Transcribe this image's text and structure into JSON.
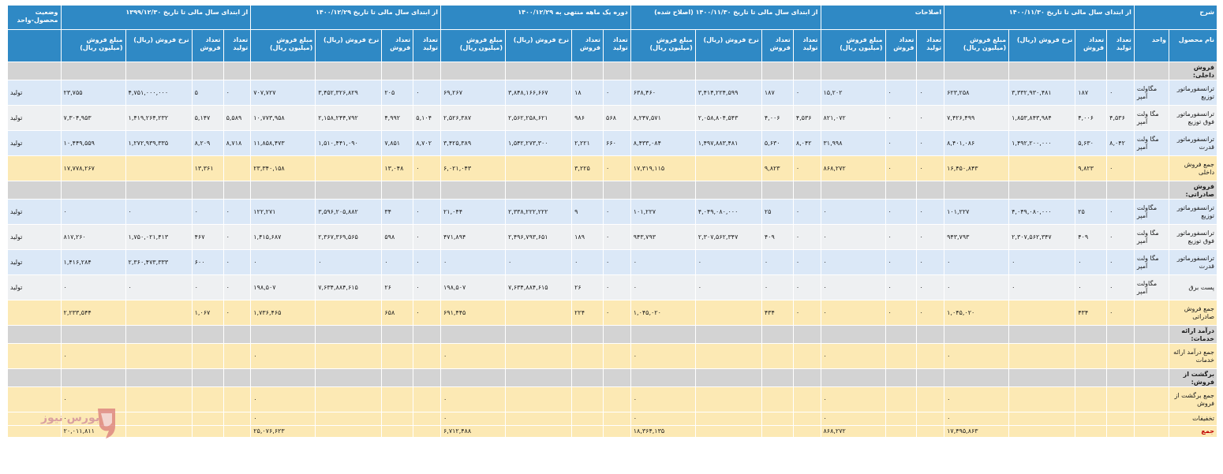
{
  "watermark": "بورس نیوز",
  "headers": {
    "row1": [
      {
        "label": "شرح",
        "colspan": 2
      },
      {
        "label": "از ابتدای سال مالی تا تاریخ ۱۴۰۰/۱۱/۳۰",
        "colspan": 4
      },
      {
        "label": "اصلاحات",
        "colspan": 3
      },
      {
        "label": "از ابتدای سال مالی تا تاریخ ۱۴۰۰/۱۱/۳۰ (اصلاح شده)",
        "colspan": 4
      },
      {
        "label": "دوره یک ماهه منتهی به ۱۴۰۰/۱۲/۲۹",
        "colspan": 4
      },
      {
        "label": "از ابتدای سال مالی تا تاریخ ۱۴۰۰/۱۲/۲۹",
        "colspan": 4
      },
      {
        "label": "از ابتدای سال مالی تا تاریخ ۱۳۹۹/۱۲/۳۰",
        "colspan": 4
      },
      {
        "label": "وضعیت محصول-واحد",
        "colspan": 1
      }
    ],
    "row2": [
      "نام محصول",
      "واحد",
      "تعداد تولید",
      "تعداد فروش",
      "نرخ فروش (ریال)",
      "مبلغ فروش (میلیون ریال)",
      "تعداد تولید",
      "تعداد فروش",
      "مبلغ فروش (میلیون ریال)",
      "تعداد تولید",
      "تعداد فروش",
      "نرخ فروش (ریال)",
      "مبلغ فروش (میلیون ریال)",
      "تعداد تولید",
      "تعداد فروش",
      "نرخ فروش (ریال)",
      "مبلغ فروش (میلیون ریال)",
      "تعداد تولید",
      "تعداد فروش",
      "نرخ فروش (ریال)",
      "مبلغ فروش (میلیون ریال)",
      "تعداد تولید",
      "تعداد فروش",
      "نرخ فروش (ریال)",
      "مبلغ فروش (میلیون ریال)",
      ""
    ]
  },
  "rows": [
    {
      "type": "sec",
      "label": "فروش داخلی:"
    },
    {
      "type": "dat",
      "shade": "a",
      "cells": [
        "ترانسفورماتور توزیع",
        "مگاولت آمپر",
        "۰",
        "۱۸۷",
        "۳,۳۳۲,۹۳۰,۴۸۱",
        "۶۲۳,۲۵۸",
        "۰",
        "۰",
        "۱۵,۲۰۲",
        "۰",
        "۱۸۷",
        "۳,۴۱۴,۲۲۴,۵۹۹",
        "۶۳۸,۴۶۰",
        "۰",
        "۱۸",
        "۳,۸۴۸,۱۶۶,۶۶۷",
        "۶۹,۲۶۷",
        "۰",
        "۲۰۵",
        "۳,۴۵۲,۳۲۶,۸۲۹",
        "۷۰۷,۷۲۷",
        "۰",
        "۵",
        "۴,۷۵۱,۰۰۰,۰۰۰",
        "۲۳,۷۵۵",
        "تولید"
      ]
    },
    {
      "type": "dat",
      "shade": "b",
      "cells": [
        "ترانسفورماتور فوق توزیع",
        "مگا ولت آمپر",
        "۴,۵۳۶",
        "۴,۰۰۶",
        "۱,۸۵۳,۸۴۳,۹۸۴",
        "۷,۴۲۶,۴۹۹",
        "۰",
        "۰",
        "۸۲۱,۰۷۲",
        "۴,۵۳۶",
        "۴,۰۰۶",
        "۲,۰۵۸,۸۰۴,۵۴۳",
        "۸,۲۴۷,۵۷۱",
        "۵۶۸",
        "۹۸۶",
        "۲,۵۶۲,۲۵۸,۶۲۱",
        "۲,۵۲۶,۳۸۷",
        "۵,۱۰۴",
        "۴,۹۹۲",
        "۲,۱۵۸,۲۴۴,۷۹۲",
        "۱۰,۷۷۳,۹۵۸",
        "۵,۵۸۹",
        "۵,۱۴۷",
        "۱,۴۱۹,۲۶۴,۲۳۲",
        "۷,۳۰۴,۹۵۳",
        "تولید"
      ]
    },
    {
      "type": "dat",
      "shade": "a",
      "cells": [
        "ترانسفورماتور قدرت",
        "مگا ولت آمپر",
        "۸,۰۴۲",
        "۵,۶۳۰",
        "۱,۴۹۲,۲۰۰,۰۰۰",
        "۸,۴۰۱,۰۸۶",
        "۰",
        "۰",
        "۳۱,۹۹۸",
        "۸,۰۴۲",
        "۵,۶۳۰",
        "۱,۴۹۷,۸۸۳,۴۸۱",
        "۸,۴۳۳,۰۸۴",
        "۶۶۰",
        "۲,۲۲۱",
        "۱,۵۴۲,۲۷۳,۳۰۰",
        "۳,۴۲۵,۳۸۹",
        "۸,۷۰۲",
        "۷,۸۵۱",
        "۱,۵۱۰,۴۴۱,۰۹۰",
        "۱۱,۸۵۸,۴۷۳",
        "۸,۷۱۸",
        "۸,۲۰۹",
        "۱,۲۷۲,۹۳۹,۳۳۵",
        "۱۰,۴۴۹,۵۵۹",
        "تولید"
      ]
    },
    {
      "type": "tot",
      "cells": [
        "جمع فروش داخلی",
        "",
        "۰",
        "۹,۸۲۳",
        "",
        "۱۶,۴۵۰,۸۴۳",
        "۰",
        "۰",
        "۸۶۸,۲۷۲",
        "۰",
        "۹,۸۲۳",
        "",
        "۱۷,۳۱۹,۱۱۵",
        "۰",
        "۳,۲۲۵",
        "",
        "۶,۰۲۱,۰۴۳",
        "۰",
        "۱۳,۰۴۸",
        "",
        "۲۳,۳۴۰,۱۵۸",
        "",
        "۱۳,۳۶۱",
        "",
        "۱۷,۷۷۸,۲۶۷",
        ""
      ]
    },
    {
      "type": "sec",
      "label": "فروش صادراتی:"
    },
    {
      "type": "dat",
      "shade": "a",
      "cells": [
        "ترانسفورماتور توزیع",
        "مگاولت آمپر",
        "۰",
        "۲۵",
        "۴,۰۴۹,۰۸۰,۰۰۰",
        "۱۰۱,۲۲۷",
        "۰",
        "۰",
        "۰",
        "۰",
        "۲۵",
        "۴,۰۴۹,۰۸۰,۰۰۰",
        "۱۰۱,۲۲۷",
        "۰",
        "۹",
        "۲,۳۳۸,۲۲۲,۲۲۲",
        "۲۱,۰۴۴",
        "۰",
        "۳۴",
        "۳,۵۹۶,۲۰۵,۸۸۲",
        "۱۲۲,۲۷۱",
        "۰",
        "۰",
        "۰",
        "۰",
        "تولید"
      ]
    },
    {
      "type": "dat",
      "shade": "b",
      "cells": [
        "ترانسفورماتور فوق توزیع",
        "مگا ولت آمپر",
        "۰",
        "۴۰۹",
        "۲,۳۰۷,۵۶۲,۳۴۷",
        "۹۴۳,۷۹۳",
        "۰",
        "۰",
        "۰",
        "۰",
        "۴۰۹",
        "۲,۳۰۷,۵۶۲,۳۴۷",
        "۹۴۳,۷۹۳",
        "۰",
        "۱۸۹",
        "۲,۴۹۶,۷۹۳,۶۵۱",
        "۴۷۱,۸۹۴",
        "۰",
        "۵۹۸",
        "۲,۳۶۷,۳۶۹,۵۶۵",
        "۱,۴۱۵,۶۸۷",
        "۰",
        "۴۶۷",
        "۱,۷۵۰,۰۲۱,۴۱۳",
        "۸۱۷,۲۶۰",
        "تولید"
      ]
    },
    {
      "type": "dat",
      "shade": "a",
      "cells": [
        "ترانسفورماتور قدرت",
        "مگا ولت آمپر",
        "۰",
        "۰",
        "۰",
        "۰",
        "۰",
        "۰",
        "۰",
        "۰",
        "۰",
        "۰",
        "۰",
        "۰",
        "۰",
        "۰",
        "۰",
        "۰",
        "۰",
        "۰",
        "۰",
        "۰",
        "۶۰۰",
        "۲,۳۶۰,۴۷۳,۳۳۳",
        "۱,۴۱۶,۲۸۴",
        "تولید"
      ]
    },
    {
      "type": "dat",
      "shade": "b",
      "cells": [
        "پست برق",
        "مگاولت آمپر",
        "۰",
        "۰",
        "۰",
        "۰",
        "۰",
        "۰",
        "۰",
        "۰",
        "۰",
        "۰",
        "۰",
        "۰",
        "۲۶",
        "۷,۶۳۴,۸۸۴,۶۱۵",
        "۱۹۸,۵۰۷",
        "۰",
        "۲۶",
        "۷,۶۳۴,۸۸۴,۶۱۵",
        "۱۹۸,۵۰۷",
        "۰",
        "۰",
        "۰",
        "۰",
        "تولید"
      ]
    },
    {
      "type": "tot",
      "cells": [
        "جمع فروش صادراتی",
        "",
        "۰",
        "۴۳۴",
        "",
        "۱,۰۴۵,۰۲۰",
        "۰",
        "۰",
        "۰",
        "۰",
        "۴۳۴",
        "",
        "۱,۰۴۵,۰۲۰",
        "۰",
        "۲۲۴",
        "",
        "۶۹۱,۴۴۵",
        "۰",
        "۶۵۸",
        "",
        "۱,۷۳۶,۴۶۵",
        "۰",
        "۱,۰۶۷",
        "",
        "۲,۲۳۳,۵۴۴",
        ""
      ]
    },
    {
      "type": "sec",
      "label": "درآمد ارائه خدمات:"
    },
    {
      "type": "tot",
      "cells": [
        "جمع درآمد ارائه خدمات",
        "",
        "",
        "",
        "",
        "۰",
        "",
        "",
        "۰",
        "",
        "",
        "",
        "۰",
        "",
        "",
        "",
        "۰",
        "",
        "",
        "",
        "۰",
        "",
        "",
        "",
        "۰",
        ""
      ]
    },
    {
      "type": "sec",
      "label": "برگشت از فروش:"
    },
    {
      "type": "tot",
      "cells": [
        "جمع برگشت از فروش",
        "",
        "",
        "",
        "",
        "۰",
        "",
        "",
        "۰",
        "",
        "",
        "",
        "۰",
        "",
        "",
        "",
        "۰",
        "",
        "",
        "",
        "۰",
        "",
        "",
        "",
        "۰",
        ""
      ]
    },
    {
      "type": "tot",
      "variant": "s",
      "cells": [
        "تخفیفات",
        "",
        "",
        "",
        "",
        "۰",
        "",
        "",
        "۰",
        "",
        "",
        "",
        "۰",
        "",
        "",
        "",
        "۰",
        "",
        "",
        "",
        "۰",
        "",
        "",
        "",
        "۰",
        ""
      ]
    },
    {
      "type": "tot",
      "variant": "x",
      "cells": [
        "جمع",
        "",
        "",
        "",
        "",
        "۱۷,۴۹۵,۸۶۳",
        "",
        "",
        "۸۶۸,۲۷۲",
        "",
        "",
        "",
        "۱۸,۳۶۴,۱۳۵",
        "",
        "",
        "",
        "۶,۷۱۲,۴۸۸",
        "",
        "",
        "",
        "۲۵,۰۷۶,۶۲۳",
        "",
        "",
        "",
        "۲۰,۰۱۱,۸۱۱",
        ""
      ]
    }
  ]
}
